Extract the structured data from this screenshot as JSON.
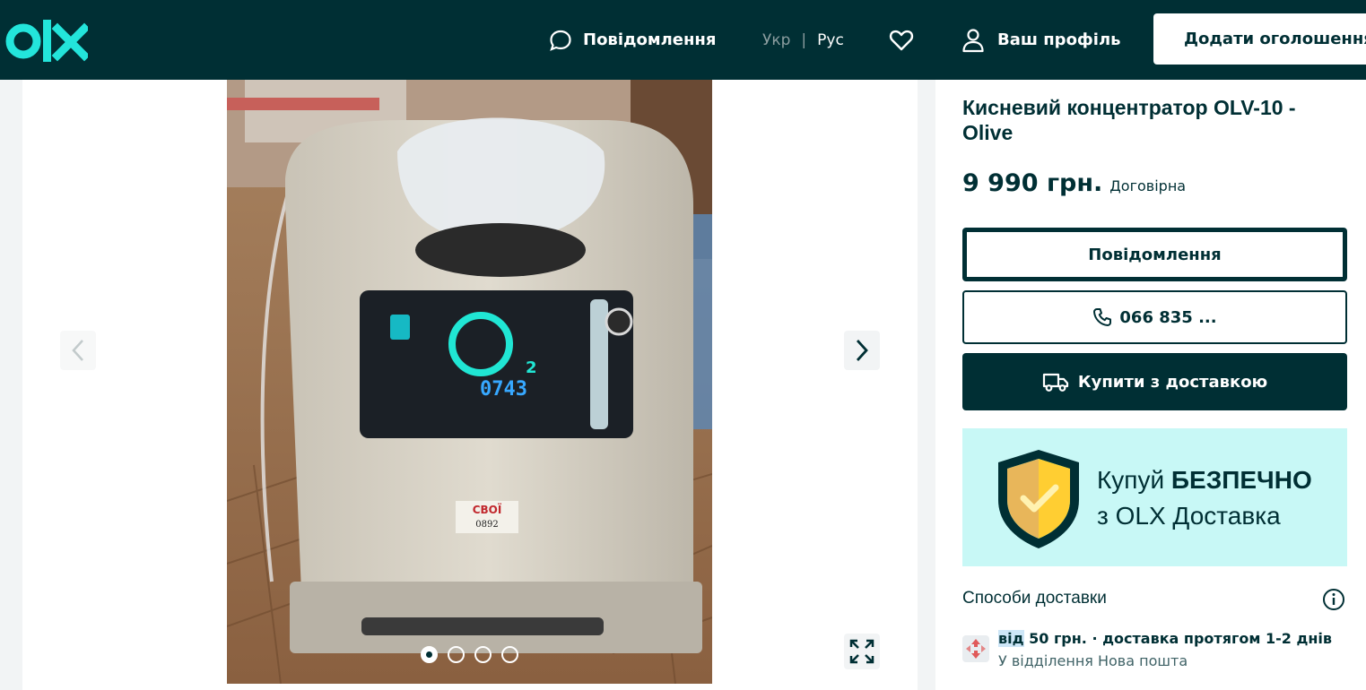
{
  "header": {
    "logo_text": "olx",
    "messages_label": "Повідомлення",
    "lang_ukr": "Укр",
    "lang_rus": "Рус",
    "profile_label": "Ваш профіль",
    "add_listing_label": "Додати оголошення"
  },
  "gallery": {
    "photo_count": 4,
    "active_index": 0,
    "sticker_text": "СВОЇ",
    "sticker_number": "0892",
    "display_reading": "0743",
    "display_o2": "O2"
  },
  "listing": {
    "title": "Кисневий концентратор OLV-10 - Olive",
    "price": "9 990 грн.",
    "negotiable": "Договірна",
    "message_button": "Повідомлення",
    "phone_button": "066 835 ...",
    "buy_button": "Купити з доставкою",
    "promo_line1_a": "Купуй ",
    "promo_line1_b": "БЕЗПЕЧНО",
    "promo_line2": "з OLX Доставка",
    "delivery_heading": "Способи доставки",
    "delivery_from": "від",
    "delivery_main_rest": " 50 грн. · доставка протягом 1-2 днів",
    "delivery_sub": "У відділення Нова пошта"
  },
  "colors": {
    "brand_dark": "#002f34",
    "brand_teal": "#23e5db",
    "promo_bg": "#c8f8f6"
  }
}
